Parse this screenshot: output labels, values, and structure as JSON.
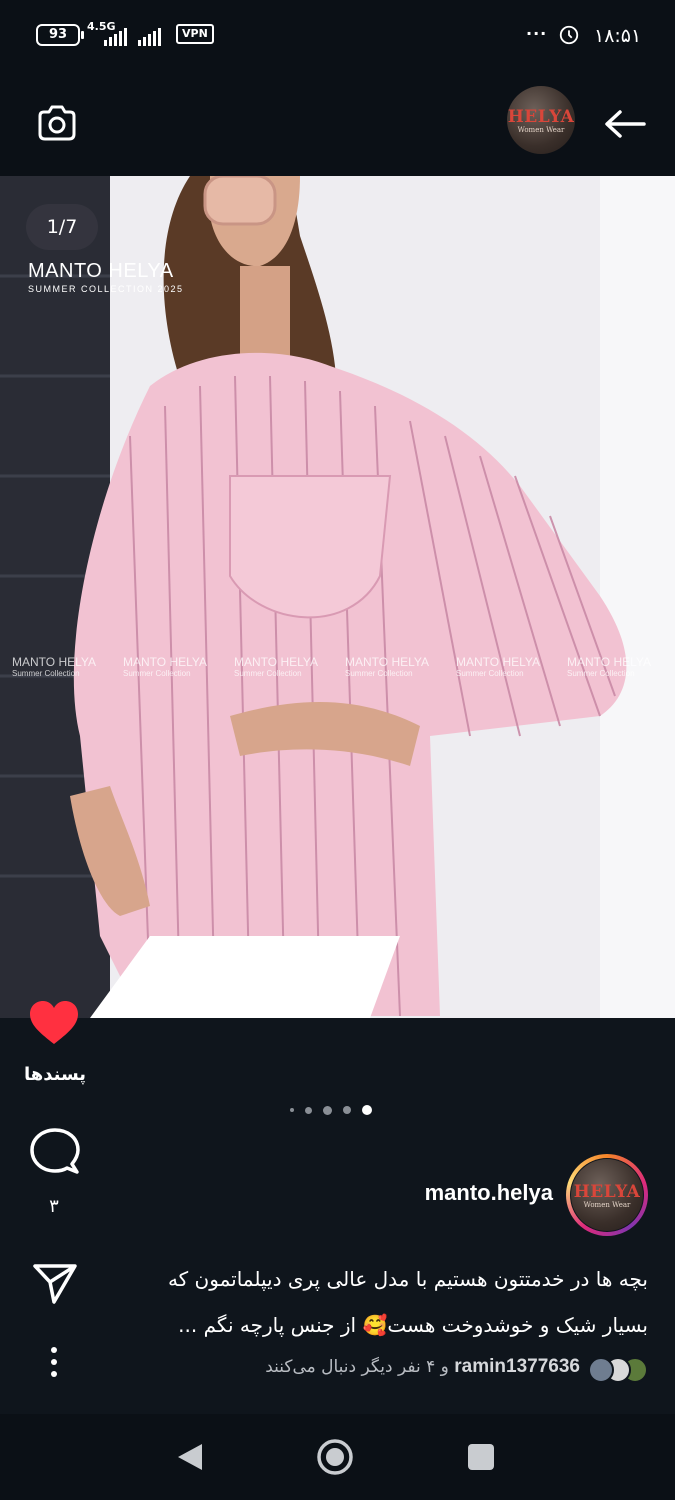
{
  "status_bar": {
    "battery": "93",
    "network": "4.5G",
    "vpn": "VPN",
    "overflow": "···",
    "time": "۱۸:۵۱"
  },
  "header": {
    "camera_icon": "camera-icon",
    "back_icon": "arrow-back-icon",
    "avatar_logo": "HELYA",
    "avatar_logo_sub": "Women Wear"
  },
  "photo": {
    "counter": "1/7",
    "brand_title": "MANTO HELYA",
    "brand_subtitle": "SUMMER COLLECTION 2025",
    "watermarks": [
      {
        "title": "MANTO HELYA",
        "subtitle": "Summer Collection"
      },
      {
        "title": "MANTO HELYA",
        "subtitle": "Summer Collection"
      },
      {
        "title": "MANTO HELYA",
        "subtitle": "Summer Collection"
      },
      {
        "title": "MANTO HELYA",
        "subtitle": "Summer Collection"
      },
      {
        "title": "MANTO HELYA",
        "subtitle": "Summer Collection"
      },
      {
        "title": "MANTO HELYA",
        "subtitle": "Summer Collection"
      }
    ]
  },
  "actions": {
    "like_icon": "heart-icon",
    "like_color": "#ff3040",
    "likes_label": "پسندها",
    "comment_icon": "comment-icon",
    "comment_count": "۳",
    "share_icon": "send-icon",
    "more_icon": "more-vertical-icon",
    "pager_total": 5,
    "pager_active": 5
  },
  "post": {
    "username": "manto.helya",
    "caption_line1": "بچه ها در خدمتتون هستیم با مدل عالی پری دیپلماتمون که",
    "caption_line2": "بسیار شیک و خوشدوخت هست🥰 از جنس پارچه نگم ...",
    "follower_name": "ramin1377636",
    "follower_text": " و ۴ نفر دیگر دنبال می‌کنند"
  },
  "nav": {
    "back_icon": "nav-back-icon",
    "home_icon": "nav-home-icon",
    "recent_icon": "nav-recent-icon"
  }
}
